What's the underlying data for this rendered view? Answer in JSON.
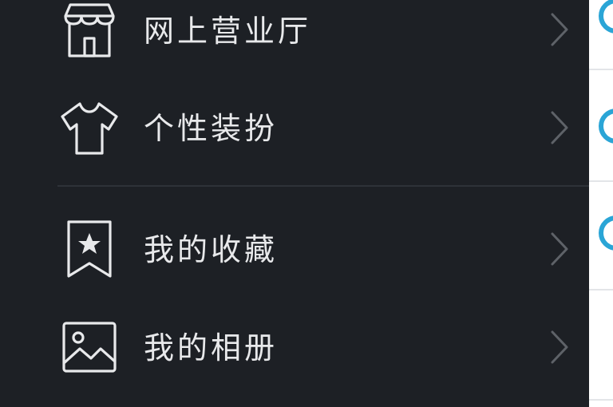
{
  "menu": {
    "items": [
      {
        "label": "网上营业厅",
        "icon": "store-icon"
      },
      {
        "label": "个性装扮",
        "icon": "tshirt-icon"
      },
      {
        "label": "我的收藏",
        "icon": "bookmark-star-icon"
      },
      {
        "label": "我的相册",
        "icon": "image-icon"
      }
    ]
  },
  "colors": {
    "drawer_bg": "#1d2025",
    "text": "#e8e9eb",
    "icon_stroke": "#e8e9eb",
    "chevron": "#5e6268",
    "divider": "#2e3238",
    "side_panel_bg": "#ffffff",
    "side_accent": "#2aa5d6"
  }
}
